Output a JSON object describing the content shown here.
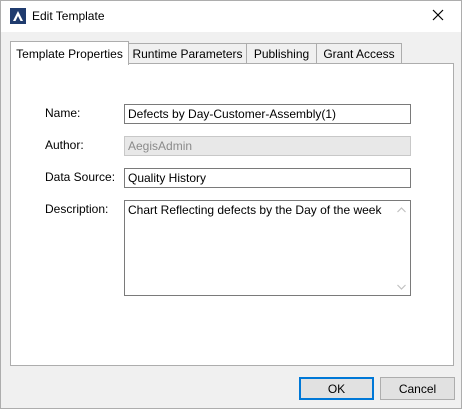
{
  "window": {
    "title": "Edit Template",
    "icon": "app-logo-icon",
    "close_icon": "close-icon"
  },
  "tabs": [
    {
      "label": "Template Properties",
      "active": true
    },
    {
      "label": "Runtime Parameters",
      "active": false
    },
    {
      "label": "Publishing",
      "active": false
    },
    {
      "label": "Grant Access",
      "active": false
    }
  ],
  "form": {
    "name_label": "Name:",
    "name_value": "Defects by Day-Customer-Assembly(1)",
    "author_label": "Author:",
    "author_value": "AegisAdmin",
    "data_source_label": "Data Source:",
    "data_source_value": "Quality History",
    "description_label": "Description:",
    "description_value": "Chart Reflecting defects by the Day of the week"
  },
  "buttons": {
    "ok_label": "OK",
    "cancel_label": "Cancel"
  },
  "colors": {
    "accent": "#0078d7",
    "border": "#adadad",
    "disabled_bg": "#e8e8e8"
  }
}
